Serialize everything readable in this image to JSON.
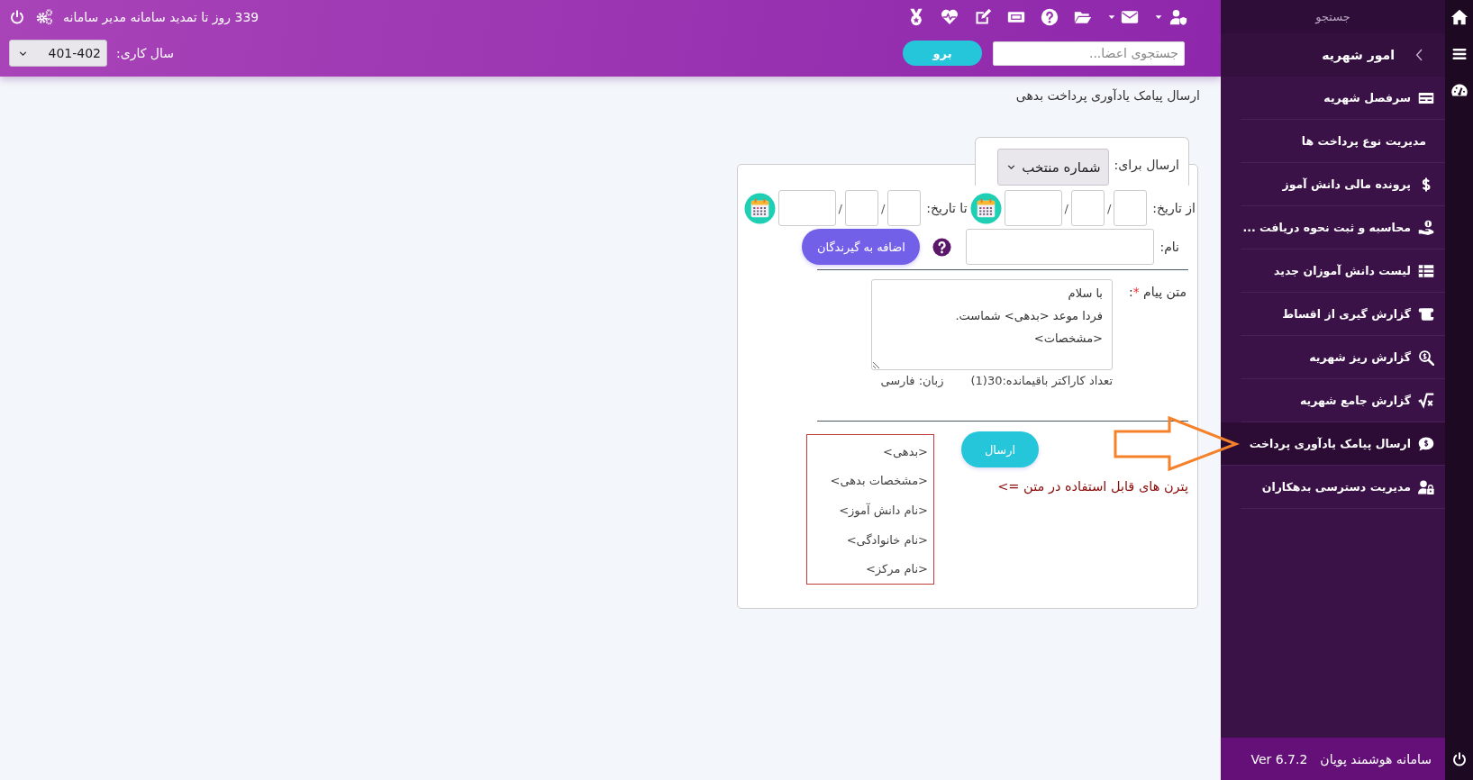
{
  "top_bar": {
    "notice": "339 روز تا تمدید سامانه مدیر سامانه",
    "year_label": "سال کاری:",
    "year_select": "401-402",
    "search": {
      "placeholder": "جستجوی اعضا..."
    },
    "go_button": "برو"
  },
  "page_title": "ارسال پیامک یادآوری پرداخت بدهی",
  "form": {
    "send_to_label": "ارسال برای:",
    "send_to_select": "شماره منتخب",
    "from_date": {
      "label": "از تاریخ:",
      "separators": [
        "/",
        "/"
      ]
    },
    "to_date": {
      "label": "تا تاریخ:",
      "separators": [
        "/",
        "/"
      ]
    },
    "name_label": "نام:",
    "add_button": "اضافه به گیرندگان",
    "message_label": "متن پیام",
    "required_mark": "*",
    "label_suffix": ":",
    "message_lines": [
      "با سلام",
      "فردا موعد <بدهی> شماست.",
      "<مشخصات>"
    ],
    "char_count": "تعداد کاراکتر باقیمانده:30(1)",
    "language": "زبان: فارسی",
    "send_button": "ارسال",
    "patterns_hint": "پترن های قابل استفاده در متن =>",
    "patterns": [
      "<بدهی>",
      "<مشخصات بدهی>",
      "<نام دانش آموز>",
      "<نام خانوادگی>",
      "<نام مرکز>"
    ]
  },
  "sidebar": {
    "search_label": "جستجو",
    "section": "امور شهریه",
    "items": [
      {
        "label": "سرفصل شهریه",
        "selected": false
      },
      {
        "label": "مدیریت نوع پرداخت ها",
        "selected": false
      },
      {
        "label": "پرونده مالی دانش آموز",
        "selected": false
      },
      {
        "label": "محاسبه و ثبت نحوه دریافت ...",
        "selected": false
      },
      {
        "label": "لیست دانش آموزان جدید",
        "selected": false
      },
      {
        "label": "گزارش گیری از اقساط",
        "selected": false
      },
      {
        "label": "گزارش ریز شهریه",
        "selected": false
      },
      {
        "label": "گزارش جامع شهریه",
        "selected": false
      },
      {
        "label": "ارسال پیامک یادآوری پرداخت",
        "selected": true
      },
      {
        "label": "مدیریت دسترسی بدهکاران",
        "selected": false
      }
    ],
    "footer": {
      "product": "سامانه هوشمند پویان",
      "version": "Ver 6.7.2"
    }
  }
}
